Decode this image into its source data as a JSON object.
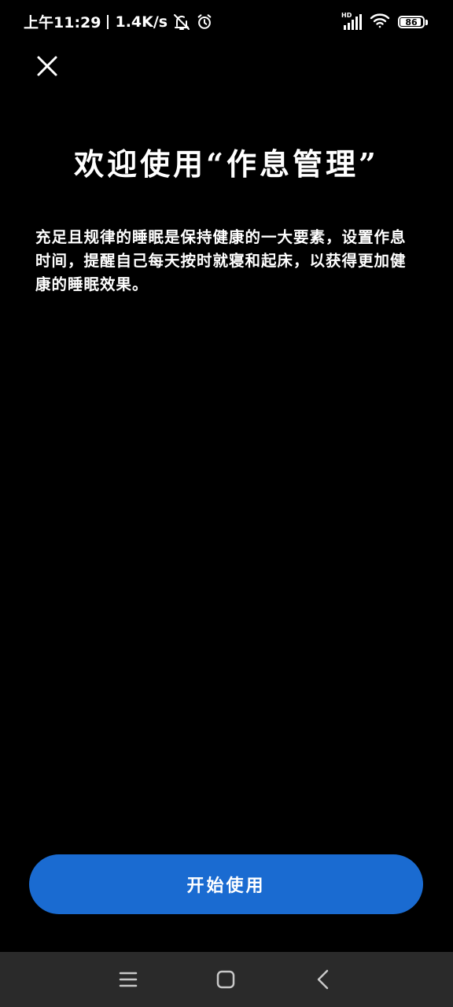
{
  "status_bar": {
    "time": "上午11:29",
    "net_speed": "1.4K/s",
    "signal_label": "HD",
    "battery_level": "86",
    "icons": [
      "vibrate-off-icon",
      "alarm-icon",
      "hd-signal-icon",
      "wifi-icon",
      "battery-icon"
    ]
  },
  "header": {
    "close_icon": "close-icon"
  },
  "main": {
    "title": "欢迎使用“作息管理”",
    "description": "充足且规律的睡眠是保持健康的一大要素，设置作息时间，提醒自己每天按时就寝和起床，以获得更加健康的睡眠效果。"
  },
  "footer": {
    "start_label": "开始使用",
    "start_color": "#1a6bd1"
  },
  "nav_bar": {
    "icons": [
      "menu-icon",
      "home-icon",
      "back-icon"
    ]
  },
  "colors": {
    "background": "#000000",
    "text": "#ffffff",
    "accent": "#1a6bd1",
    "nav_background": "#2a2a2a"
  }
}
